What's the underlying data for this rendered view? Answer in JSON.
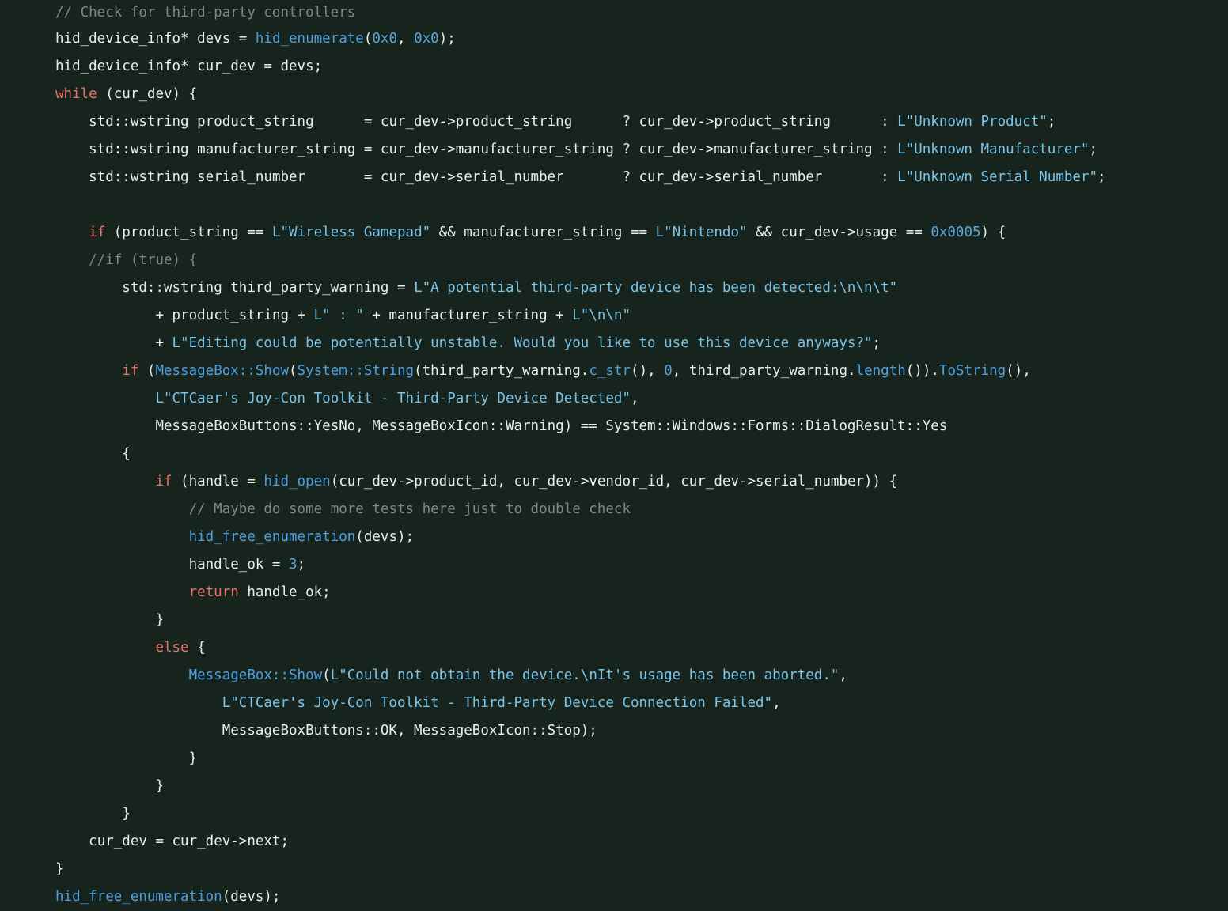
{
  "editor": {
    "language": "cpp",
    "theme": "dark-green",
    "background_color": "#16241d",
    "colors": {
      "default": "#e9edec",
      "comment": "#7d8a83",
      "keyword": "#e8736a",
      "string": "#79c4e8",
      "number": "#5aa4da",
      "function": "#4e9fe0"
    }
  },
  "code": {
    "lines": [
      {
        "indent": 0,
        "tokens": [
          {
            "t": "comment",
            "v": "// Check for third-party controllers"
          }
        ]
      },
      {
        "indent": 0,
        "tokens": [
          {
            "t": "default",
            "v": "hid_device_info* devs = "
          },
          {
            "t": "func",
            "v": "hid_enumerate"
          },
          {
            "t": "default",
            "v": "("
          },
          {
            "t": "number",
            "v": "0x0"
          },
          {
            "t": "default",
            "v": ", "
          },
          {
            "t": "number",
            "v": "0x0"
          },
          {
            "t": "default",
            "v": ");"
          }
        ]
      },
      {
        "indent": 0,
        "tokens": [
          {
            "t": "default",
            "v": "hid_device_info* cur_dev = devs;"
          }
        ]
      },
      {
        "indent": 0,
        "tokens": [
          {
            "t": "keyword",
            "v": "while"
          },
          {
            "t": "default",
            "v": " (cur_dev) {"
          }
        ]
      },
      {
        "indent": 1,
        "tokens": [
          {
            "t": "default",
            "v": "std::wstring product_string      = cur_dev->product_string      ? cur_dev->product_string      : "
          },
          {
            "t": "string",
            "v": "L\"Unknown Product\""
          },
          {
            "t": "default",
            "v": ";"
          }
        ]
      },
      {
        "indent": 1,
        "tokens": [
          {
            "t": "default",
            "v": "std::wstring manufacturer_string = cur_dev->manufacturer_string ? cur_dev->manufacturer_string : "
          },
          {
            "t": "string",
            "v": "L\"Unknown Manufacturer\""
          },
          {
            "t": "default",
            "v": ";"
          }
        ]
      },
      {
        "indent": 1,
        "tokens": [
          {
            "t": "default",
            "v": "std::wstring serial_number       = cur_dev->serial_number       ? cur_dev->serial_number       : "
          },
          {
            "t": "string",
            "v": "L\"Unknown Serial Number\""
          },
          {
            "t": "default",
            "v": ";"
          }
        ]
      },
      {
        "indent": 0,
        "tokens": [
          {
            "t": "default",
            "v": ""
          }
        ]
      },
      {
        "indent": 1,
        "tokens": [
          {
            "t": "keyword",
            "v": "if"
          },
          {
            "t": "default",
            "v": " (product_string == "
          },
          {
            "t": "string",
            "v": "L\"Wireless Gamepad\""
          },
          {
            "t": "default",
            "v": " && manufacturer_string == "
          },
          {
            "t": "string",
            "v": "L\"Nintendo\""
          },
          {
            "t": "default",
            "v": " && cur_dev->usage == "
          },
          {
            "t": "number",
            "v": "0x0005"
          },
          {
            "t": "default",
            "v": ") {"
          }
        ]
      },
      {
        "indent": 1,
        "tokens": [
          {
            "t": "comment",
            "v": "//if (true) {"
          }
        ]
      },
      {
        "indent": 2,
        "tokens": [
          {
            "t": "default",
            "v": "std::wstring third_party_warning = "
          },
          {
            "t": "string",
            "v": "L\"A potential third-party device has been detected:\\n\\n\\t\""
          }
        ]
      },
      {
        "indent": 3,
        "tokens": [
          {
            "t": "default",
            "v": "+ product_string + "
          },
          {
            "t": "string",
            "v": "L\" : \""
          },
          {
            "t": "default",
            "v": " + manufacturer_string + "
          },
          {
            "t": "string",
            "v": "L\"\\n\\n\""
          }
        ]
      },
      {
        "indent": 3,
        "tokens": [
          {
            "t": "default",
            "v": "+ "
          },
          {
            "t": "string",
            "v": "L\"Editing could be potentially unstable. Would you like to use this device anyways?\""
          },
          {
            "t": "default",
            "v": ";"
          }
        ]
      },
      {
        "indent": 2,
        "tokens": [
          {
            "t": "keyword",
            "v": "if"
          },
          {
            "t": "default",
            "v": " ("
          },
          {
            "t": "func",
            "v": "MessageBox::Show"
          },
          {
            "t": "default",
            "v": "("
          },
          {
            "t": "func",
            "v": "System::String"
          },
          {
            "t": "default",
            "v": "(third_party_warning."
          },
          {
            "t": "func",
            "v": "c_str"
          },
          {
            "t": "default",
            "v": "(), "
          },
          {
            "t": "number",
            "v": "0"
          },
          {
            "t": "default",
            "v": ", third_party_warning."
          },
          {
            "t": "func",
            "v": "length"
          },
          {
            "t": "default",
            "v": "())."
          },
          {
            "t": "func",
            "v": "ToString"
          },
          {
            "t": "default",
            "v": "(),"
          }
        ]
      },
      {
        "indent": 3,
        "tokens": [
          {
            "t": "string",
            "v": "L\"CTCaer's Joy-Con Toolkit - Third-Party Device Detected\""
          },
          {
            "t": "default",
            "v": ","
          }
        ]
      },
      {
        "indent": 3,
        "tokens": [
          {
            "t": "default",
            "v": "MessageBoxButtons::YesNo, MessageBoxIcon::Warning) == System::Windows::Forms::DialogResult::Yes"
          }
        ]
      },
      {
        "indent": 2,
        "tokens": [
          {
            "t": "default",
            "v": "{"
          }
        ]
      },
      {
        "indent": 3,
        "tokens": [
          {
            "t": "keyword",
            "v": "if"
          },
          {
            "t": "default",
            "v": " (handle = "
          },
          {
            "t": "func",
            "v": "hid_open"
          },
          {
            "t": "default",
            "v": "(cur_dev->product_id, cur_dev->vendor_id, cur_dev->serial_number)) {"
          }
        ]
      },
      {
        "indent": 4,
        "tokens": [
          {
            "t": "comment",
            "v": "// Maybe do some more tests here just to double check"
          }
        ]
      },
      {
        "indent": 4,
        "tokens": [
          {
            "t": "func",
            "v": "hid_free_enumeration"
          },
          {
            "t": "default",
            "v": "(devs);"
          }
        ]
      },
      {
        "indent": 4,
        "tokens": [
          {
            "t": "default",
            "v": "handle_ok = "
          },
          {
            "t": "number",
            "v": "3"
          },
          {
            "t": "default",
            "v": ";"
          }
        ]
      },
      {
        "indent": 4,
        "tokens": [
          {
            "t": "keyword",
            "v": "return"
          },
          {
            "t": "default",
            "v": " handle_ok;"
          }
        ]
      },
      {
        "indent": 3,
        "tokens": [
          {
            "t": "default",
            "v": "}"
          }
        ]
      },
      {
        "indent": 3,
        "tokens": [
          {
            "t": "keyword",
            "v": "else"
          },
          {
            "t": "default",
            "v": " {"
          }
        ]
      },
      {
        "indent": 4,
        "tokens": [
          {
            "t": "func",
            "v": "MessageBox::Show"
          },
          {
            "t": "default",
            "v": "("
          },
          {
            "t": "string",
            "v": "L\"Could not obtain the device.\\nIt's usage has been aborted.\""
          },
          {
            "t": "default",
            "v": ","
          }
        ]
      },
      {
        "indent": 5,
        "tokens": [
          {
            "t": "string",
            "v": "L\"CTCaer's Joy-Con Toolkit - Third-Party Device Connection Failed\""
          },
          {
            "t": "default",
            "v": ","
          }
        ]
      },
      {
        "indent": 5,
        "tokens": [
          {
            "t": "default",
            "v": "MessageBoxButtons::OK, MessageBoxIcon::Stop);"
          }
        ]
      },
      {
        "indent": 4,
        "tokens": [
          {
            "t": "default",
            "v": "}"
          }
        ]
      },
      {
        "indent": 3,
        "tokens": [
          {
            "t": "default",
            "v": "}"
          }
        ]
      },
      {
        "indent": 2,
        "tokens": [
          {
            "t": "default",
            "v": "}"
          }
        ]
      },
      {
        "indent": 1,
        "tokens": [
          {
            "t": "default",
            "v": "cur_dev = cur_dev->next;"
          }
        ]
      },
      {
        "indent": 0,
        "tokens": [
          {
            "t": "default",
            "v": "}"
          }
        ]
      },
      {
        "indent": 0,
        "tokens": [
          {
            "t": "func",
            "v": "hid_free_enumeration"
          },
          {
            "t": "default",
            "v": "(devs);"
          }
        ]
      }
    ]
  }
}
